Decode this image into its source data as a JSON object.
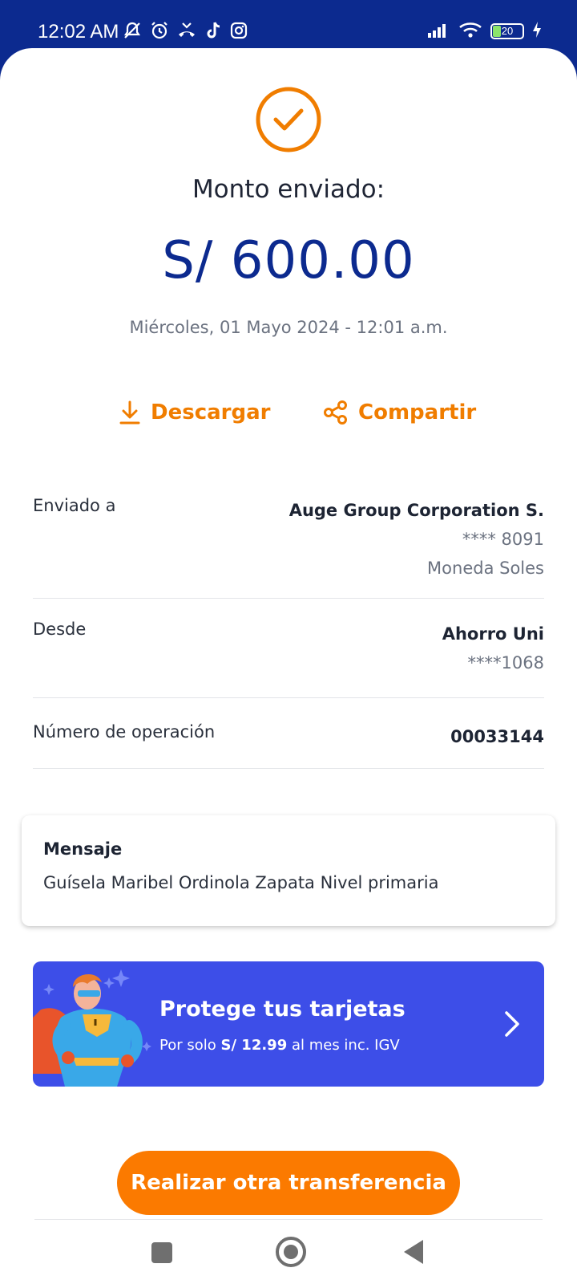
{
  "status_bar": {
    "time": "12:02 AM",
    "battery": "20",
    "icons_left": [
      "mute-icon",
      "alarm-icon",
      "missed-call-icon",
      "tiktok-icon",
      "instagram-icon"
    ],
    "icons_right": [
      "signal-icon",
      "wifi-icon",
      "battery-icon",
      "charging-icon"
    ]
  },
  "receipt": {
    "title": "Monto enviado:",
    "amount": "S/ 600.00",
    "date": "Miércoles, 01 Mayo 2024 - 12:01 a.m."
  },
  "actions": {
    "download_label": "Descargar",
    "share_label": "Compartir"
  },
  "details": {
    "sent_to": {
      "label": "Enviado a",
      "name": "Auge Group Corporation S.",
      "account": "**** 8091",
      "currency": "Moneda Soles"
    },
    "from": {
      "label": "Desde",
      "account_name": "Ahorro Uni",
      "account": "****1068"
    },
    "operation": {
      "label": "Número de operación",
      "value": "00033144"
    }
  },
  "message": {
    "title": "Mensaje",
    "text": "Guísela Maribel Ordinola Zapata Nivel primaria"
  },
  "promo": {
    "title": "Protege tus tarjetas",
    "sub_prefix": "Por solo ",
    "sub_price": "S/ 12.99",
    "sub_suffix": " al mes inc. IGV"
  },
  "cta_label": "Realizar otra transferencia",
  "colors": {
    "brand_blue": "#0c2a8f",
    "accent_orange": "#f07d00",
    "promo_blue": "#3d4ee8",
    "cta_orange": "#fb7a00"
  }
}
